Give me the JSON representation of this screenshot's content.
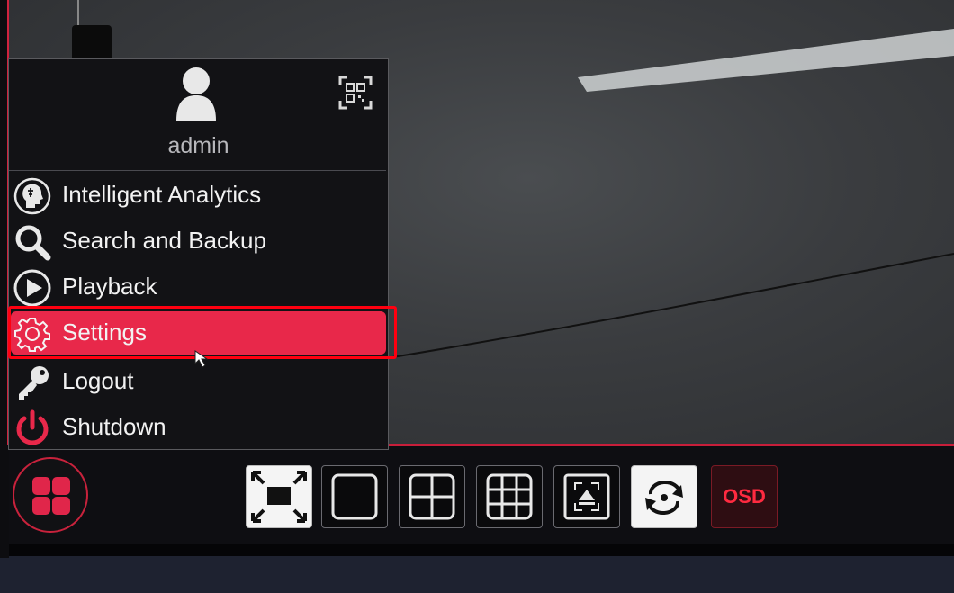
{
  "user": {
    "name": "admin"
  },
  "menu": {
    "items": [
      {
        "label": "Intelligent Analytics",
        "icon": "analytics-head-icon"
      },
      {
        "label": "Search and Backup",
        "icon": "search-icon"
      },
      {
        "label": "Playback",
        "icon": "play-circle-icon"
      },
      {
        "label": "Settings",
        "icon": "gear-icon",
        "selected": true
      },
      {
        "label": "Logout",
        "icon": "key-icon"
      },
      {
        "label": "Shutdown",
        "icon": "power-icon"
      }
    ]
  },
  "toolbar": {
    "buttons": [
      "fullscreen-icon",
      "single-view-icon",
      "quad-view-icon",
      "nine-view-icon",
      "sequence-icon",
      "rotate-icon"
    ],
    "osd_label": "OSD"
  },
  "colors": {
    "accent": "#e8284a",
    "highlight": "#ff0010",
    "panel": "#121215"
  }
}
